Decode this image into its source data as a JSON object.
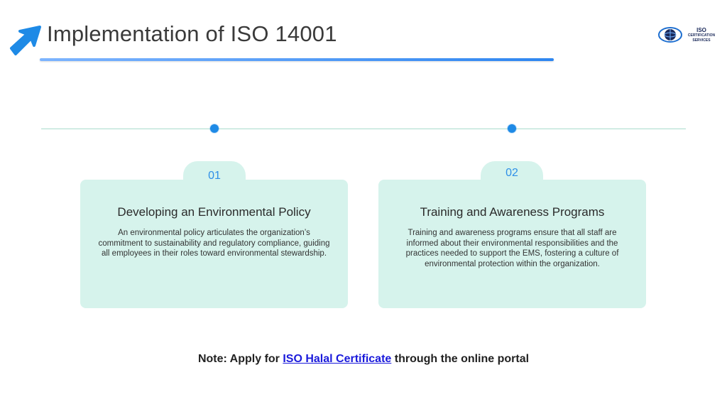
{
  "header": {
    "title": "Implementation of ISO 14001"
  },
  "logo": {
    "line1": "ISO",
    "line2": "CERTIFICATION",
    "line3": "SERVICES"
  },
  "steps": [
    {
      "number": "01",
      "title": "Developing an Environmental Policy",
      "text": "An environmental policy articulates the organization’s commitment to sustainability and regulatory compliance, guiding all employees in their roles toward environmental stewardship."
    },
    {
      "number": "02",
      "title": "Training and Awareness Programs",
      "text": "Training and awareness programs ensure that all staff are informed about their environmental responsibilities and the practices needed to support the EMS, fostering a culture of environmental protection within the organization."
    }
  ],
  "note": {
    "prefix": "Note: Apply for",
    "link": "ISO Halal Certificate",
    "suffix": "through the online portal"
  },
  "colors": {
    "accent": "#1e8ae6",
    "card_bg": "#d6f3ec",
    "link": "#1a1adb"
  }
}
